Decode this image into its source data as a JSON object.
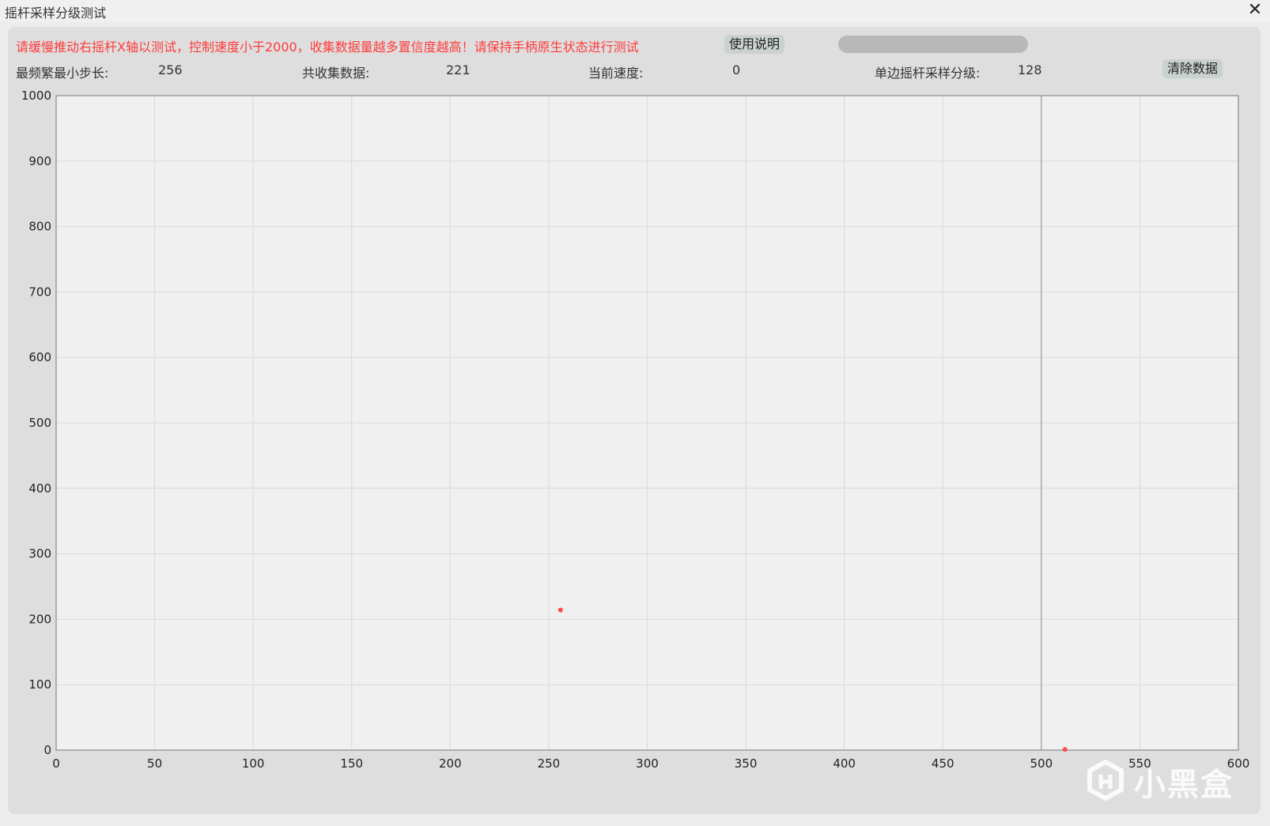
{
  "window": {
    "title": "摇杆采样分级测试",
    "close_glyph": "✕"
  },
  "toolbar": {
    "notice": "请缓慢推动右摇杆X轴以测试，控制速度小于2000，收集数据量越多置信度越高！请保持手柄原生状态进行测试",
    "help_label": "使用说明",
    "clear_label": "清除数据",
    "notice_color": "#ff3b3b"
  },
  "stats": {
    "min_step_label": "最频繁最小步长:",
    "min_step_value": "256",
    "collected_label": "共收集数据:",
    "collected_value": "221",
    "speed_label": "当前速度:",
    "speed_value": "0",
    "levels_label": "单边摇杆采样分级:",
    "levels_value": "128"
  },
  "chart_data": {
    "type": "scatter",
    "xlim": [
      0,
      600
    ],
    "ylim": [
      0,
      1000
    ],
    "x_ticks": [
      0,
      50,
      100,
      150,
      200,
      250,
      300,
      350,
      400,
      450,
      500,
      550,
      600
    ],
    "y_ticks": [
      0,
      100,
      200,
      300,
      400,
      500,
      600,
      700,
      800,
      900,
      1000
    ],
    "grid": true,
    "marker_x": 500,
    "points": [
      {
        "x": 256,
        "y": 214
      },
      {
        "x": 512,
        "y": 1
      }
    ],
    "point_color": "#ff4a4a"
  },
  "watermark": {
    "text": "小黑盒"
  }
}
